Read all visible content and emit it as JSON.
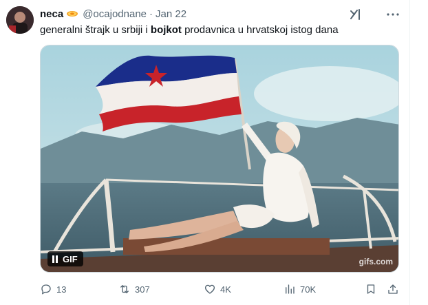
{
  "tweet": {
    "author_name": "neca",
    "badge_icon": "sun-emoji-icon",
    "handle": "@ocajodnane",
    "separator": "·",
    "date": "Jan 22",
    "text_before": "generalni štrajk u srbiji i ",
    "text_bold": "bojkot",
    "text_after": " prodavnica u hrvatskoj istog dana"
  },
  "media": {
    "gif_label": "GIF",
    "watermark": "gifs.com"
  },
  "actions": {
    "replies": "13",
    "reposts": "307",
    "likes": "4K",
    "views": "70K"
  },
  "icons": [
    "grok-icon",
    "more-icon",
    "reply-icon",
    "repost-icon",
    "like-icon",
    "views-icon",
    "bookmark-icon",
    "share-icon",
    "pause-icon"
  ],
  "colors": {
    "text_primary": "#0f1419",
    "text_secondary": "#536471",
    "border": "#cfd9de"
  }
}
